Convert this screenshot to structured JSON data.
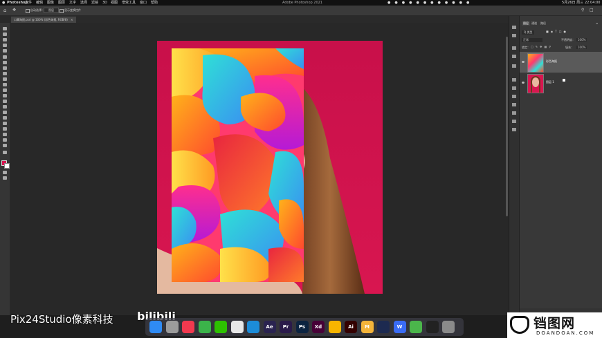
{
  "menubar": {
    "app": "Photoshop",
    "items": [
      "文件",
      "编辑",
      "图像",
      "图层",
      "文字",
      "选择",
      "滤镜",
      "3D",
      "视图",
      "增效工具",
      "窗口",
      "帮助"
    ],
    "title": "Adobe Photoshop 2021",
    "date": "5月26日 周三",
    "time": "22:04:00"
  },
  "options": {
    "label1": "自动选择：",
    "label2": "图层",
    "label3": "显示变换控件"
  },
  "document": {
    "tab": "口罩海报.psd @ 100% (彩色海报, RGB/8)"
  },
  "layers_panel": {
    "tabs": [
      "图层",
      "通道",
      "路径"
    ],
    "filter_label": "Q 类型",
    "blend_mode": "正常",
    "opacity_label": "不透明度：",
    "opacity_value": "100%",
    "lock_label": "锁定：",
    "fill_label": "填充：",
    "fill_value": "100%",
    "layers": [
      {
        "name": "彩色海报",
        "selected": true
      },
      {
        "name": "图层 1",
        "selected": false
      }
    ]
  },
  "dock": {
    "apps": [
      {
        "name": "finder",
        "label": "",
        "color": "#2f8bf5"
      },
      {
        "name": "launchpad",
        "label": "",
        "color": "#9b9b9b"
      },
      {
        "name": "music",
        "label": "",
        "color": "#f2394f"
      },
      {
        "name": "chrome",
        "label": "",
        "color": "#3bb34a"
      },
      {
        "name": "wechat",
        "label": "",
        "color": "#2dc100"
      },
      {
        "name": "qq",
        "label": "",
        "color": "#e8e8e8"
      },
      {
        "name": "browser",
        "label": "",
        "color": "#1c8cd8"
      },
      {
        "name": "after-effects",
        "label": "Ae",
        "color": "#2a2350"
      },
      {
        "name": "premiere",
        "label": "Pr",
        "color": "#2a1a4a"
      },
      {
        "name": "photoshop",
        "label": "Ps",
        "color": "#0b2340"
      },
      {
        "name": "xd",
        "label": "Xd",
        "color": "#470137"
      },
      {
        "name": "sketch",
        "label": "",
        "color": "#f7b500"
      },
      {
        "name": "illustrator",
        "label": "Ai",
        "color": "#330000"
      },
      {
        "name": "mindnode",
        "label": "M",
        "color": "#f4b43a"
      },
      {
        "name": "cinema4d",
        "label": "",
        "color": "#1d2a50"
      },
      {
        "name": "wps",
        "label": "W",
        "color": "#3a6cf5"
      },
      {
        "name": "camtasia",
        "label": "",
        "color": "#4bb64b"
      },
      {
        "name": "terminal",
        "label": "",
        "color": "#222222"
      },
      {
        "name": "trash",
        "label": "",
        "color": "#8a8a8a"
      }
    ]
  },
  "watermark": {
    "text": "Pix24Studio像素科技",
    "bili": "bilibili"
  },
  "brand": {
    "main": "铛图网",
    "sub": "DOANDOAN.COM"
  },
  "colors": {
    "background": "#d81650",
    "accent": "#0b2340"
  }
}
